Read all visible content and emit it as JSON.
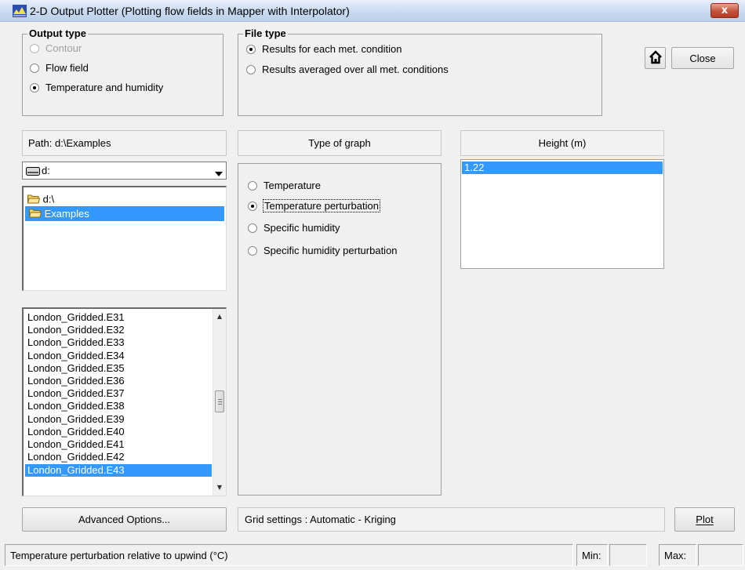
{
  "window": {
    "title": "2-D Output Plotter (Plotting flow fields in Mapper with Interpolator)",
    "close_glyph": "x"
  },
  "output_type": {
    "title": "Output type",
    "options": [
      {
        "label": "Contour",
        "selected": false,
        "disabled": true
      },
      {
        "label": "Flow field",
        "selected": false,
        "disabled": false
      },
      {
        "label": "Temperature and humidity",
        "selected": true,
        "disabled": false
      }
    ]
  },
  "file_type": {
    "title": "File type",
    "options": [
      {
        "label": "Results for each met. condition",
        "selected": true
      },
      {
        "label": "Results averaged over all met. conditions",
        "selected": false
      }
    ]
  },
  "toolbar": {
    "home_icon": "home-icon",
    "close_label": "Close"
  },
  "path": {
    "label": "Path: d:\\Examples",
    "drive_value": "d:",
    "folders": [
      {
        "label": "d:\\",
        "selected": false
      },
      {
        "label": "Examples",
        "selected": true
      }
    ]
  },
  "files": {
    "items": [
      "London_Gridded.E31",
      "London_Gridded.E32",
      "London_Gridded.E33",
      "London_Gridded.E34",
      "London_Gridded.E35",
      "London_Gridded.E36",
      "London_Gridded.E37",
      "London_Gridded.E38",
      "London_Gridded.E39",
      "London_Gridded.E40",
      "London_Gridded.E41",
      "London_Gridded.E42",
      "London_Gridded.E43"
    ],
    "selected": "London_Gridded.E43"
  },
  "graph": {
    "header": "Type of graph",
    "options": [
      {
        "label": "Temperature",
        "selected": false
      },
      {
        "label": "Temperature perturbation",
        "selected": true
      },
      {
        "label": "Specific humidity",
        "selected": false
      },
      {
        "label": "Specific humidity perturbation",
        "selected": false
      }
    ]
  },
  "height": {
    "header": "Height (m)",
    "items": [
      "1.22"
    ],
    "selected": "1.22"
  },
  "bottom": {
    "advanced_label": "Advanced Options...",
    "grid_settings": "Grid settings : Automatic - Kriging",
    "plot_label": "Plot"
  },
  "status": {
    "message": "Temperature perturbation relative to upwind (°C)",
    "min_label": "Min:",
    "max_label": "Max:",
    "min_value": "",
    "max_value": ""
  },
  "colors": {
    "selection": "#3399ff",
    "background": "#f0f0f0"
  }
}
